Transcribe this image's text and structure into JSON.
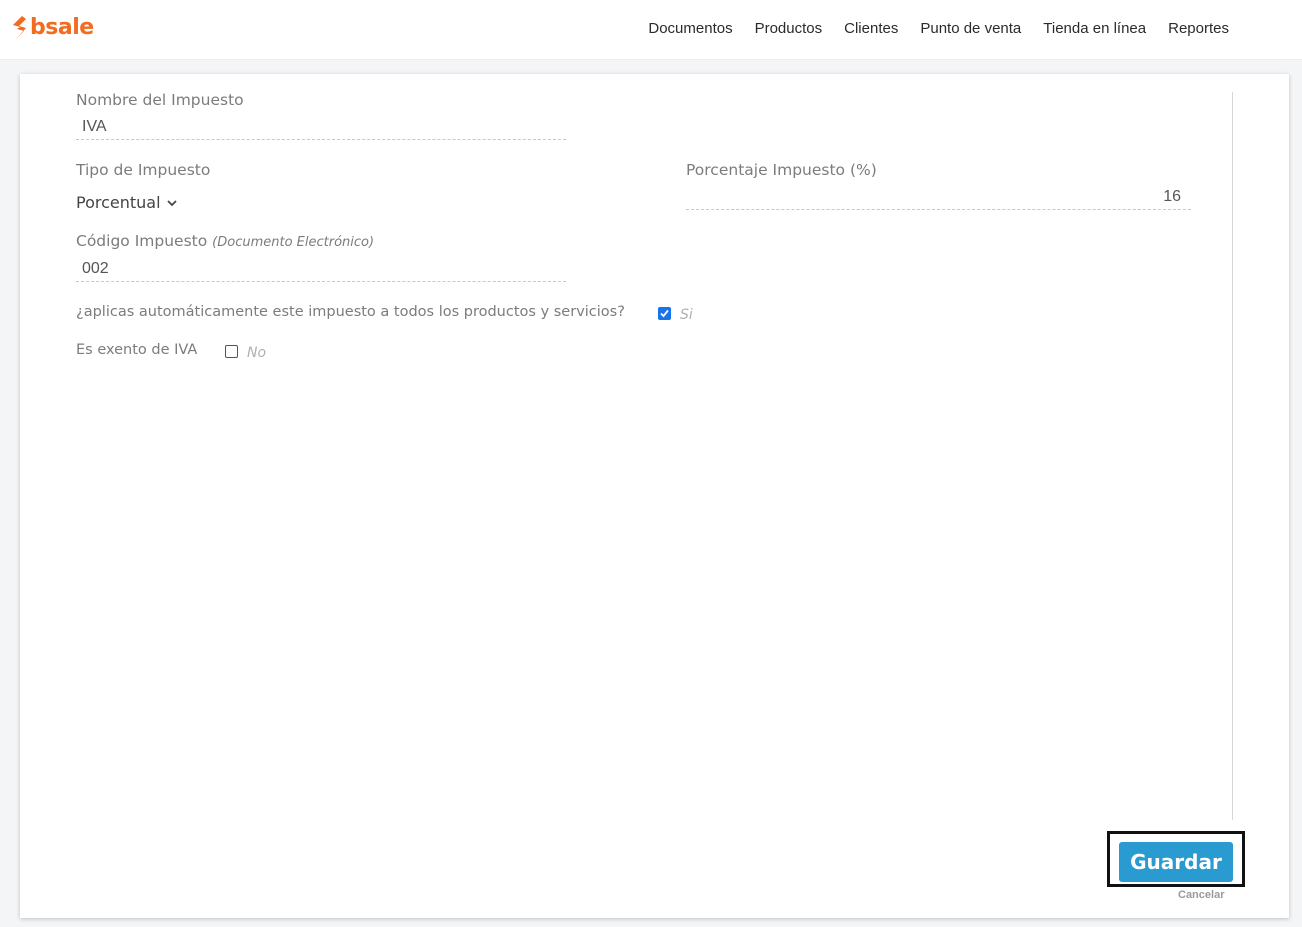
{
  "app": {
    "logo_text": "bsale",
    "brand_color": "#f26b21"
  },
  "nav": {
    "items": [
      "Documentos",
      "Productos",
      "Clientes",
      "Punto de venta",
      "Tienda en línea",
      "Reportes"
    ]
  },
  "form": {
    "nombre_label": "Nombre del Impuesto",
    "nombre_value": "IVA",
    "tipo_label": "Tipo de Impuesto",
    "tipo_value": "Porcentual",
    "porcentaje_label": "Porcentaje Impuesto (%)",
    "porcentaje_value": "16",
    "codigo_label": "Código Impuesto",
    "codigo_hint": "(Documento Electrónico)",
    "codigo_value": "002",
    "auto_question": "¿aplicas automáticamente este impuesto a todos los productos y servicios?",
    "auto_checked": true,
    "auto_text": "Si",
    "exento_label": "Es exento de IVA",
    "exento_checked": false,
    "exento_text": "No"
  },
  "actions": {
    "save_label": "Guardar",
    "save_color": "#2a9bd1",
    "cancel_label": "Cancelar"
  },
  "icons": {
    "logo": "bsale-bolt-icon",
    "dropdown": "chevron-down-icon",
    "check": "checkmark-icon"
  }
}
